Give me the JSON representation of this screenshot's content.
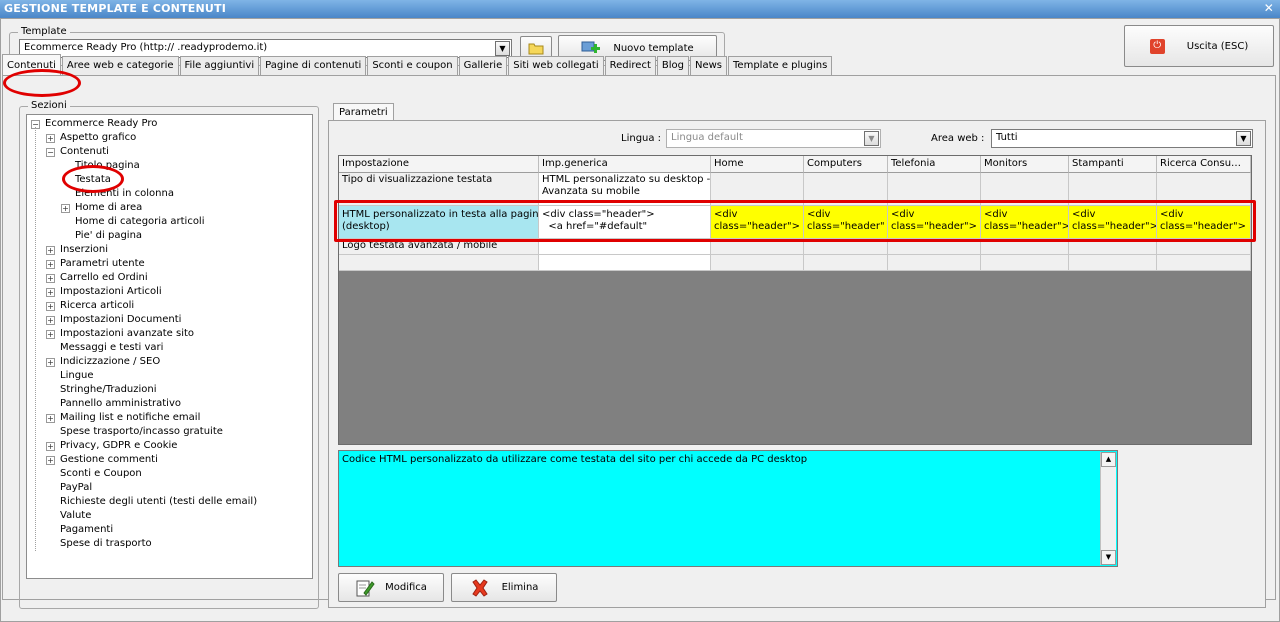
{
  "window": {
    "title": "GESTIONE TEMPLATE E CONTENUTI",
    "close_glyph": "✕"
  },
  "template_group": {
    "label": "Template",
    "combo_value": "Ecommerce Ready Pro (http://       .readyprodemo.it)",
    "folder_icon": "folder-icon",
    "new_button": "Nuovo template"
  },
  "exit_button": "Uscita (ESC)",
  "tabs": [
    "Contenuti",
    "Aree web e categorie",
    "File aggiuntivi",
    "Pagine di contenuti",
    "Sconti e coupon",
    "Gallerie",
    "Siti web collegati",
    "Redirect",
    "Blog",
    "News",
    "Template e plugins"
  ],
  "sections": {
    "label": "Sezioni",
    "tree": [
      {
        "label": "Ecommerce Ready Pro",
        "level": 0,
        "toggle": "−"
      },
      {
        "label": "Aspetto grafico",
        "level": 1,
        "toggle": "+"
      },
      {
        "label": "Contenuti",
        "level": 1,
        "toggle": "−"
      },
      {
        "label": "Titolo pagina",
        "level": 2,
        "toggle": ""
      },
      {
        "label": "Testata",
        "level": 2,
        "toggle": ""
      },
      {
        "label": "Elementi in colonna",
        "level": 2,
        "toggle": ""
      },
      {
        "label": "Home di area",
        "level": 2,
        "toggle": "+"
      },
      {
        "label": "Home di categoria articoli",
        "level": 2,
        "toggle": ""
      },
      {
        "label": "Pie' di pagina",
        "level": 2,
        "toggle": ""
      },
      {
        "label": "Inserzioni",
        "level": 1,
        "toggle": "+"
      },
      {
        "label": "Parametri utente",
        "level": 1,
        "toggle": "+"
      },
      {
        "label": "Carrello ed Ordini",
        "level": 1,
        "toggle": "+"
      },
      {
        "label": "Impostazioni Articoli",
        "level": 1,
        "toggle": "+"
      },
      {
        "label": "Ricerca articoli",
        "level": 1,
        "toggle": "+"
      },
      {
        "label": "Impostazioni Documenti",
        "level": 1,
        "toggle": "+"
      },
      {
        "label": "Impostazioni avanzate sito",
        "level": 1,
        "toggle": "+"
      },
      {
        "label": "Messaggi e testi vari",
        "level": 1,
        "toggle": ""
      },
      {
        "label": "Indicizzazione / SEO",
        "level": 1,
        "toggle": "+"
      },
      {
        "label": "Lingue",
        "level": 1,
        "toggle": ""
      },
      {
        "label": "Stringhe/Traduzioni",
        "level": 1,
        "toggle": ""
      },
      {
        "label": "Pannello amministrativo",
        "level": 1,
        "toggle": ""
      },
      {
        "label": "Mailing list e notifiche email",
        "level": 1,
        "toggle": "+"
      },
      {
        "label": "Spese trasporto/incasso gratuite",
        "level": 1,
        "toggle": ""
      },
      {
        "label": "Privacy, GDPR e Cookie",
        "level": 1,
        "toggle": "+"
      },
      {
        "label": "Gestione commenti",
        "level": 1,
        "toggle": "+"
      },
      {
        "label": "Sconti e Coupon",
        "level": 1,
        "toggle": ""
      },
      {
        "label": "PayPal",
        "level": 1,
        "toggle": ""
      },
      {
        "label": "Richieste degli utenti (testi delle email)",
        "level": 1,
        "toggle": ""
      },
      {
        "label": "Valute",
        "level": 1,
        "toggle": ""
      },
      {
        "label": "Pagamenti",
        "level": 1,
        "toggle": ""
      },
      {
        "label": "Spese di trasporto",
        "level": 1,
        "toggle": ""
      }
    ]
  },
  "params": {
    "tab": "Parametri",
    "lingua_label": "Lingua :",
    "lingua_value": "Lingua default",
    "area_label": "Area web :",
    "area_value": "Tutti"
  },
  "grid": {
    "headers": [
      "Impostazione",
      "Imp.generica",
      "Home",
      "Computers",
      "Telefonia",
      "Monitors",
      "Stampanti",
      "Ricerca Consu…"
    ],
    "rows": [
      [
        "Tipo di visualizzazione testata",
        "HTML personalizzato su desktop -\nAvanzata su mobile",
        "",
        "",
        "",
        "",
        "",
        ""
      ],
      [
        "HTML personalizzato in testa alla pagina\n(desktop)",
        "<div class=\"header\">\n  <a href=\"#default\"",
        "<div\nclass=\"header\">",
        "<div\nclass=\"header\"",
        "<div\nclass=\"header\">",
        "<div\nclass=\"header\">",
        "<div\nclass=\"header\">",
        "<div\nclass=\"header\">"
      ],
      [
        "Logo testata avanzata / mobile",
        "",
        "",
        "",
        "",
        "",
        "",
        ""
      ],
      [
        "",
        "",
        "",
        "",
        "",
        "",
        "",
        ""
      ]
    ]
  },
  "memo_text": "Codice HTML personalizzato da utilizzare come testata del sito per chi accede da PC desktop",
  "buttons": {
    "modifica": "Modifica",
    "elimina": "Elimina"
  },
  "colors": {
    "highlight_row": "#a8e6f0",
    "override_cell": "#ffff00",
    "memo_bg": "#00ffff",
    "annotation": "#e00000"
  }
}
